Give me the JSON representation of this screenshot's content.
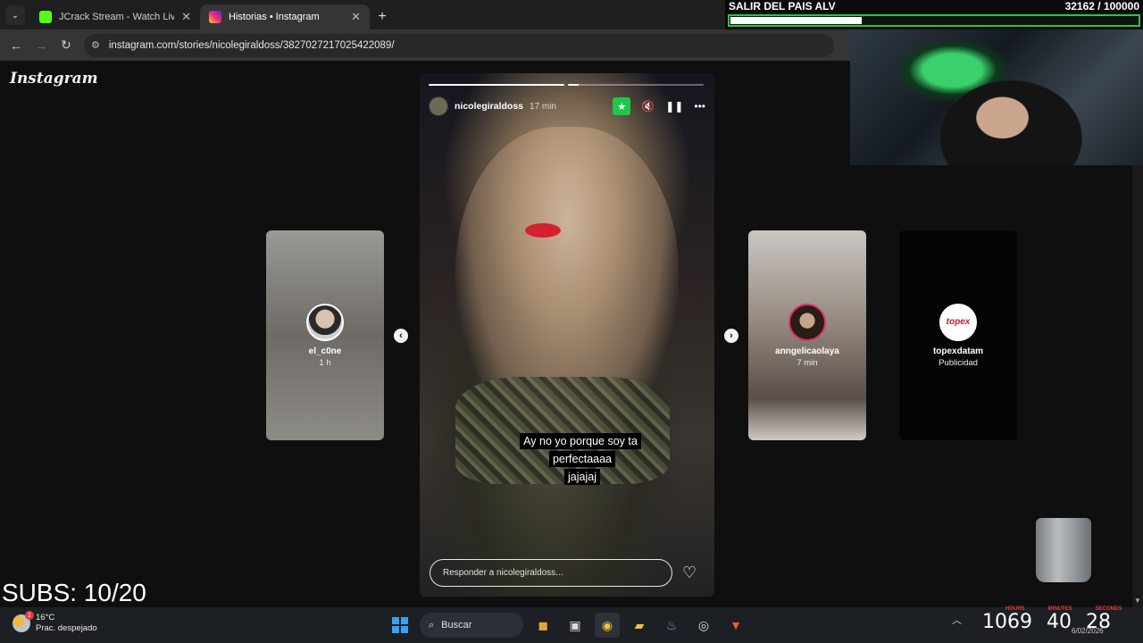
{
  "browser": {
    "tabs": [
      {
        "title": "JCrack Stream - Watch Live on K",
        "favicon_color": "#53fc18",
        "active": false
      },
      {
        "title": "Historias • Instagram",
        "favicon_color": "#d6249f",
        "active": true
      }
    ],
    "url": "instagram.com/stories/nicolegiraldoss/3827027217025422089/"
  },
  "instagram": {
    "logo": "Instagram",
    "story": {
      "username": "nicolegiraldoss",
      "time": "17 min",
      "caption_line1": "Ay no yo porque soy ta perfectaaaa",
      "caption_line2": "jajajaj",
      "reply_placeholder": "Responder a nicolegiraldoss..."
    },
    "side_stories": [
      {
        "username": "el_c0ne",
        "time": "1 h"
      },
      {
        "username": "anngelicaolaya",
        "time": "7 min"
      },
      {
        "username": "topexdatam",
        "time": "Publicidad",
        "logo_text": "topex"
      }
    ]
  },
  "overlay": {
    "goal_title": "SALIR DEL PAIS ALV",
    "goal_count": "32162  / 100000",
    "goal_progress": 0.3216,
    "subs_text": "SUBS: 10/20"
  },
  "taskbar": {
    "temperature": "16°C",
    "weather_desc": "Prac. despejado",
    "notif_count": "1",
    "search_label": "Buscar",
    "clock_hours": "1069",
    "clock_minutes": "40",
    "clock_seconds": "28",
    "clock_label_hours": "HOURS",
    "clock_label_minutes": "MINUTES",
    "clock_label_seconds": "SECONDS",
    "date": "6/02/2026"
  },
  "colors": {
    "accent_green": "#2ec24b",
    "ig_ring": "#e1306c",
    "star_badge": "#1ec74b"
  }
}
